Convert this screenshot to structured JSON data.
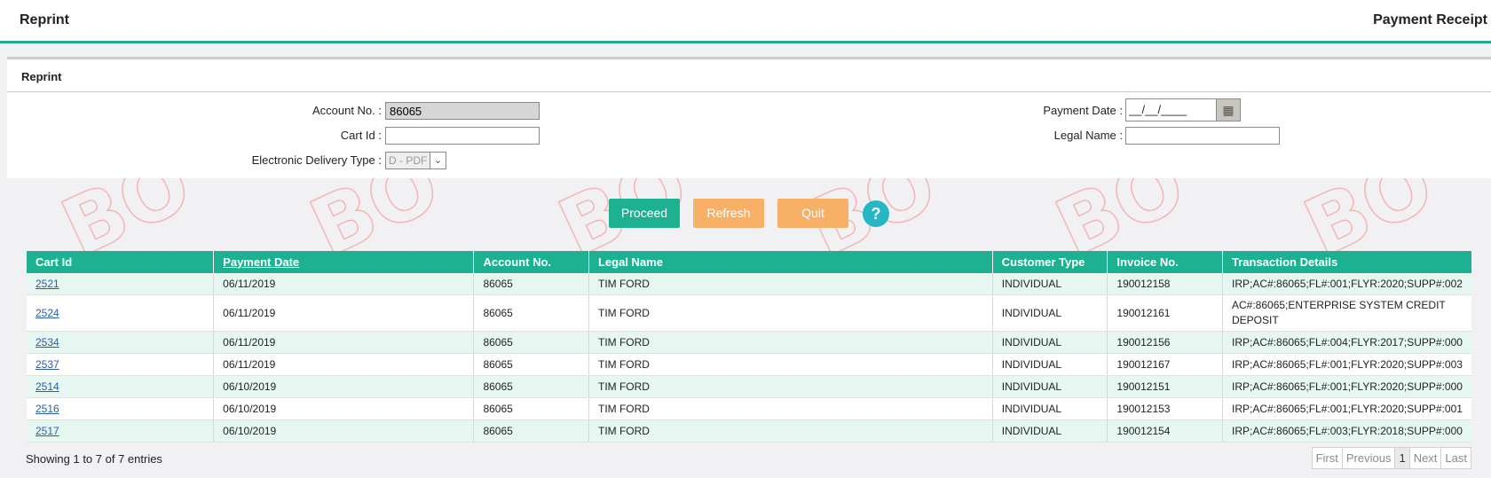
{
  "header": {
    "left_title": "Reprint",
    "right_title": "Payment Receipt"
  },
  "watermark_text": "BO",
  "panel": {
    "title": "Reprint"
  },
  "form": {
    "account_no": {
      "label": "Account No. :",
      "value": "86065"
    },
    "cart_id": {
      "label": "Cart Id :",
      "value": ""
    },
    "delivery_type": {
      "label": "Electronic Delivery Type :",
      "value": "D - PDF"
    },
    "payment_date": {
      "label": "Payment Date :",
      "value": "__/__/____"
    },
    "legal_name": {
      "label": "Legal Name :",
      "value": ""
    }
  },
  "buttons": {
    "proceed": "Proceed",
    "refresh": "Refresh",
    "quit": "Quit",
    "help": "?"
  },
  "table": {
    "headers": [
      "Cart Id",
      "Payment Date",
      "Account No.",
      "Legal Name",
      "Customer Type",
      "Invoice No.",
      "Transaction Details"
    ],
    "rows": [
      [
        "2521",
        "06/11/2019",
        "86065",
        "TIM FORD",
        "INDIVIDUAL",
        "190012158",
        "IRP;AC#:86065;FL#:001;FLYR:2020;SUPP#:002"
      ],
      [
        "2524",
        "06/11/2019",
        "86065",
        "TIM FORD",
        "INDIVIDUAL",
        "190012161",
        "AC#:86065;ENTERPRISE SYSTEM CREDIT DEPOSIT"
      ],
      [
        "2534",
        "06/11/2019",
        "86065",
        "TIM FORD",
        "INDIVIDUAL",
        "190012156",
        "IRP;AC#:86065;FL#:004;FLYR:2017;SUPP#:000"
      ],
      [
        "2537",
        "06/11/2019",
        "86065",
        "TIM FORD",
        "INDIVIDUAL",
        "190012167",
        "IRP;AC#:86065;FL#:001;FLYR:2020;SUPP#:003"
      ],
      [
        "2514",
        "06/10/2019",
        "86065",
        "TIM FORD",
        "INDIVIDUAL",
        "190012151",
        "IRP;AC#:86065;FL#:001;FLYR:2020;SUPP#:000"
      ],
      [
        "2516",
        "06/10/2019",
        "86065",
        "TIM FORD",
        "INDIVIDUAL",
        "190012153",
        "IRP;AC#:86065;FL#:001;FLYR:2020;SUPP#:001"
      ],
      [
        "2517",
        "06/10/2019",
        "86065",
        "TIM FORD",
        "INDIVIDUAL",
        "190012154",
        "IRP;AC#:86065;FL#:003;FLYR:2018;SUPP#:000"
      ]
    ]
  },
  "info": "Showing 1 to 7 of 7 entries",
  "pager": {
    "first": "First",
    "previous": "Previous",
    "current": "1",
    "next": "Next",
    "last": "Last"
  },
  "colors": {
    "accent": "#1db192",
    "orange": "#f7b066",
    "help": "#25b7c3"
  }
}
